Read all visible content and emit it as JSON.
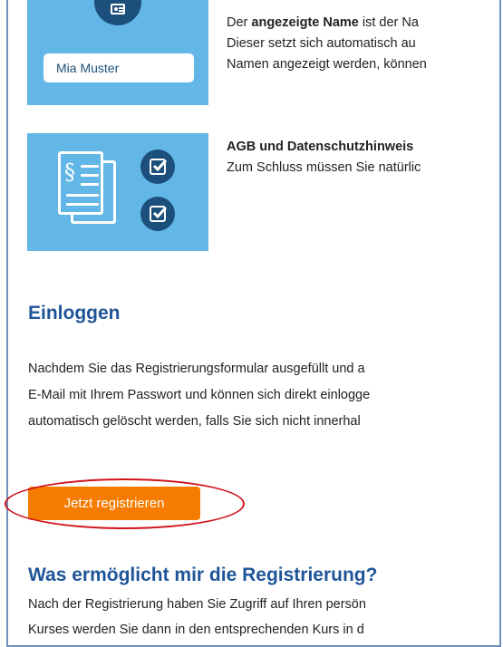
{
  "illustration_name": {
    "name_field_value": "Mia Muster",
    "icon": "id-card-icon"
  },
  "name_block": {
    "line1_pre": "Der ",
    "line1_bold": "angezeigte Name",
    "line1_post": " ist der Na",
    "line2": "Dieser setzt sich automatisch au",
    "line3": "Namen angezeigt werden, können"
  },
  "terms_block": {
    "title": "AGB und Datenschutzhinweis",
    "line2": "Zum Schluss müssen Sie natürlic",
    "icons": [
      "document-icon",
      "checkbox-icon",
      "checkbox-icon"
    ]
  },
  "login_section": {
    "heading": "Einloggen",
    "line1": "Nachdem Sie das Registrierungsformular ausgefüllt und a",
    "line2": "E-Mail mit Ihrem Passwort und können sich direkt einlogge",
    "line3": "automatisch gelöscht werden, falls Sie sich nicht innerhal",
    "button_label": "Jetzt registrieren"
  },
  "benefits_section": {
    "heading": "Was ermöglicht mir die Registrierung?",
    "line1": "Nach der Registrierung haben Sie Zugriff auf Ihren persön",
    "line2": "Kurses werden Sie dann in den entsprechenden Kurs in d"
  },
  "colors": {
    "illustration_bg": "#62b7e6",
    "icon_dark": "#1d4f7d",
    "heading": "#1f5598",
    "button": "#f57c00",
    "highlight_ring": "#d0121b",
    "frame": "#6f8fbd"
  }
}
